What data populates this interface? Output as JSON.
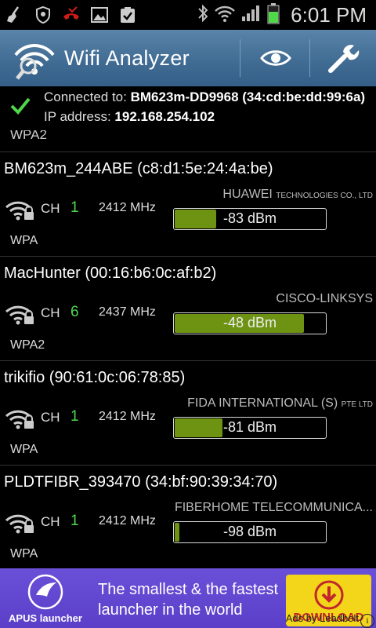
{
  "status_bar": {
    "time": "6:01 PM",
    "left_icons": [
      "broom-icon",
      "shield-icon",
      "missed-call-icon",
      "image-icon",
      "clipboard-check-icon"
    ],
    "right_icons": [
      "bluetooth-icon",
      "wifi-icon",
      "signal-icon",
      "battery-icon"
    ],
    "battery_color": "#4fd84a"
  },
  "action_bar": {
    "title": "Wifi Analyzer",
    "buttons": [
      "eye-icon",
      "wrench-icon"
    ],
    "background": "#3f6a92"
  },
  "connection": {
    "connected_label": "Connected to:",
    "connected_value": "BM623m-DD9968 (34:cd:be:dd:99:6a)",
    "ip_label": "IP address:",
    "ip_value": "192.168.254.102",
    "status_color": "#4fd84a"
  },
  "partial_item": {
    "security": "WPA2"
  },
  "access_points": [
    {
      "title": "BM623m_244ABE (c8:d1:5e:24:4a:be)",
      "ch_label": "CH",
      "channel": "1",
      "frequency": "2412 MHz",
      "vendor_main": "HUAWEI",
      "vendor_small": "TECHNOLOGIES CO., LTD",
      "signal_text": "-83 dBm",
      "signal_fraction": 0.28,
      "security": "WPA"
    },
    {
      "title": "MacHunter (00:16:b6:0c:af:b2)",
      "ch_label": "CH",
      "channel": "6",
      "frequency": "2437 MHz",
      "vendor_main": "CISCO-LINKSYS",
      "vendor_small": "",
      "signal_text": "-48 dBm",
      "signal_fraction": 0.87,
      "security": "WPA2"
    },
    {
      "title": "trikifio (90:61:0c:06:78:85)",
      "ch_label": "CH",
      "channel": "1",
      "frequency": "2412 MHz",
      "vendor_main": "FIDA INTERNATIONAL (S)",
      "vendor_small": "PTE LTD",
      "signal_text": "-81 dBm",
      "signal_fraction": 0.32,
      "security": "WPA"
    },
    {
      "title": "PLDTFIBR_393470 (34:bf:90:39:34:70)",
      "ch_label": "CH",
      "channel": "1",
      "frequency": "2412 MHz",
      "vendor_main": "FIBERHOME TELECOMMUNICA...",
      "vendor_small": "",
      "signal_text": "-98 dBm",
      "signal_fraction": 0.03,
      "security": "WPA"
    }
  ],
  "ad": {
    "brand": "APUS launcher",
    "line1": "The smallest & the fastest",
    "line2": "launcher in the world",
    "download_label": "DOWNLOAD",
    "credit": "Ads by Leadbolt",
    "info_label": "i",
    "background": "#5b3fc8",
    "download_color": "#f3d51a"
  }
}
